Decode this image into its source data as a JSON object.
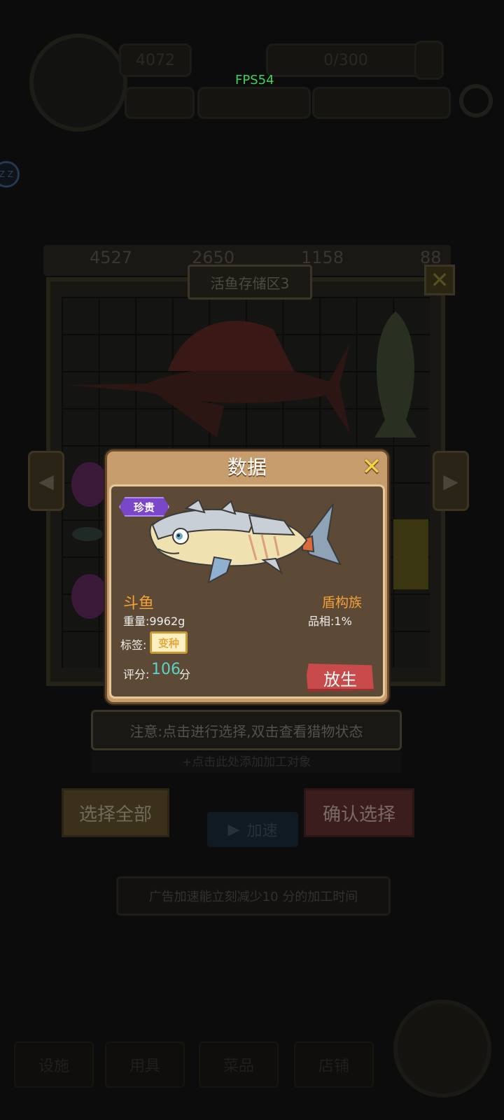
{
  "hud": {
    "top_left_value": "4072",
    "top_mid_value": "0/300",
    "fps": "FPS54",
    "side_bubble": "Z Z"
  },
  "resources": [
    "4527",
    "2650",
    "1158",
    "88"
  ],
  "storage": {
    "title": "活鱼存储区3"
  },
  "dialog": {
    "title": "数据",
    "rarity": "珍贵",
    "fish_name": "斗鱼",
    "clan": "盾构族",
    "weight_label": "重量:",
    "weight_value": "9962g",
    "quality_label": "品相:",
    "quality_value": "1%",
    "tag_label": "标签:",
    "tag_value": "变种",
    "score_label": "评分:",
    "score_value": "106",
    "score_unit": "分",
    "release_label": "放生"
  },
  "notice": "注意:点击进行选择,双击查看猎物状态",
  "hint": "+点击此处添加加工对象",
  "buttons": {
    "select_all": "选择全部",
    "confirm": "确认选择",
    "speed_up": "加速"
  },
  "ad_text": "广告加速能立刻减少10 分的加工时间",
  "bottom_tabs": [
    "设施",
    "用具",
    "菜品",
    "店铺"
  ],
  "colors": {
    "dialog_frame": "#c79d6d",
    "dialog_body": "#5c4a36",
    "name_orange": "#f2a13a",
    "score_teal": "#5fd1c9",
    "release_red": "#c94a4a",
    "rarity_purple": "#7a47c9"
  }
}
